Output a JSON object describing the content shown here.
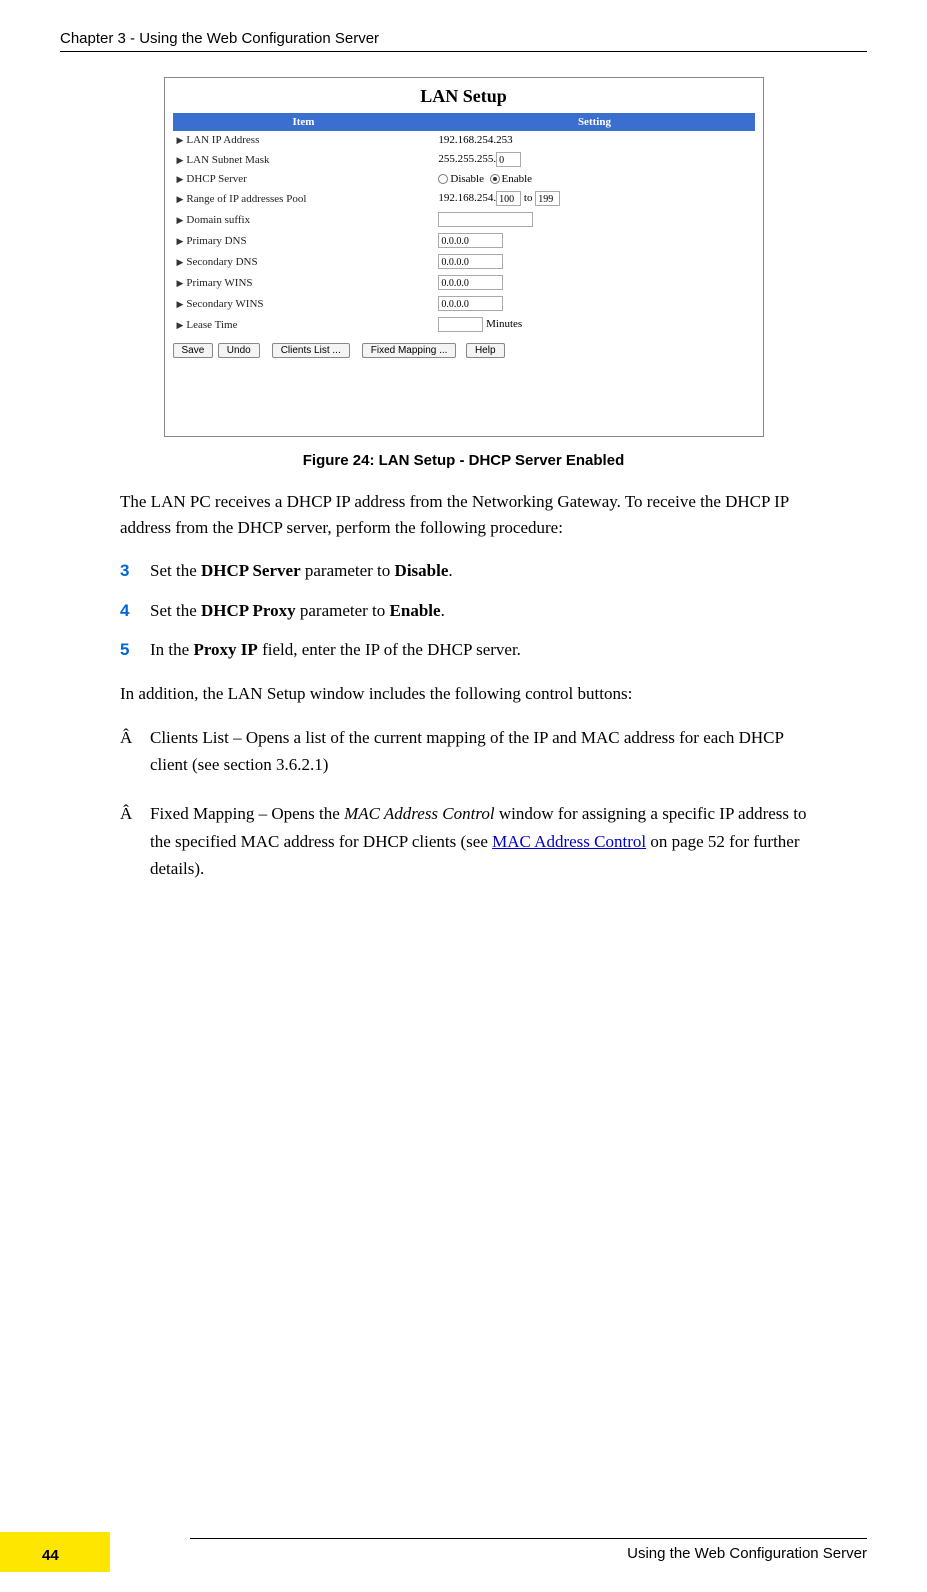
{
  "header": "Chapter 3 - Using the Web Configuration Server",
  "lan": {
    "title": "LAN Setup",
    "th_item": "Item",
    "th_setting": "Setting",
    "rows": {
      "ip_label": "LAN IP Address",
      "ip_prefix": "192.168.254.253",
      "mask_label": "LAN Subnet Mask",
      "mask_prefix": "255.255.255.",
      "mask_val": "0",
      "dhcp_label": "DHCP Server",
      "dhcp_disable": "Disable",
      "dhcp_enable": "Enable",
      "range_label": "Range of IP addresses Pool",
      "range_prefix": "192.168.254.",
      "range_to": "to",
      "range_a": "100",
      "range_b": "199",
      "domain_label": "Domain suffix",
      "pdns_label": "Primary DNS",
      "pdns_val": "0.0.0.0",
      "sdns_label": "Secondary DNS",
      "sdns_val": "0.0.0.0",
      "pwins_label": "Primary WINS",
      "pwins_val": "0.0.0.0",
      "swins_label": "Secondary WINS",
      "swins_val": "0.0.0.0",
      "lease_label": "Lease Time",
      "lease_unit": "Minutes"
    },
    "buttons": {
      "save": "Save",
      "undo": "Undo",
      "clients": "Clients List ...",
      "fixed": "Fixed Mapping ...",
      "help": "Help"
    }
  },
  "caption": "Figure 24: LAN Setup - DHCP Server Enabled",
  "intro": "The LAN PC receives a DHCP IP address from the Networking Gateway. To receive the DHCP IP address from the DHCP server, perform the following procedure:",
  "steps": {
    "s3": {
      "num": "3",
      "pre": "Set the ",
      "b1": "DHCP Server",
      "mid": " parameter to ",
      "b2": "Disable",
      "post": "."
    },
    "s4": {
      "num": "4",
      "pre": "Set the ",
      "b1": "DHCP Proxy",
      "mid": " parameter to ",
      "b2": "Enable",
      "post": "."
    },
    "s5": {
      "num": "5",
      "pre": "In the ",
      "b1": "Proxy IP",
      "post": " field, enter the IP of the DHCP server."
    }
  },
  "addition": "In addition, the LAN Setup window includes the following control buttons:",
  "bullets": {
    "sym": "Â",
    "b1": "Clients List – Opens a list of the current mapping of the IP and MAC address for each DHCP client (see section 3.6.2.1)",
    "b2_pre": "Fixed Mapping – Opens the ",
    "b2_i": "MAC Address Control",
    "b2_mid": " window for assigning a specific IP address to the specified MAC address for DHCP clients (see ",
    "b2_link": "MAC Address Control",
    "b2_post": " on page 52 for further details)."
  },
  "footer_text": "Using the Web Configuration Server",
  "page_number": "44"
}
